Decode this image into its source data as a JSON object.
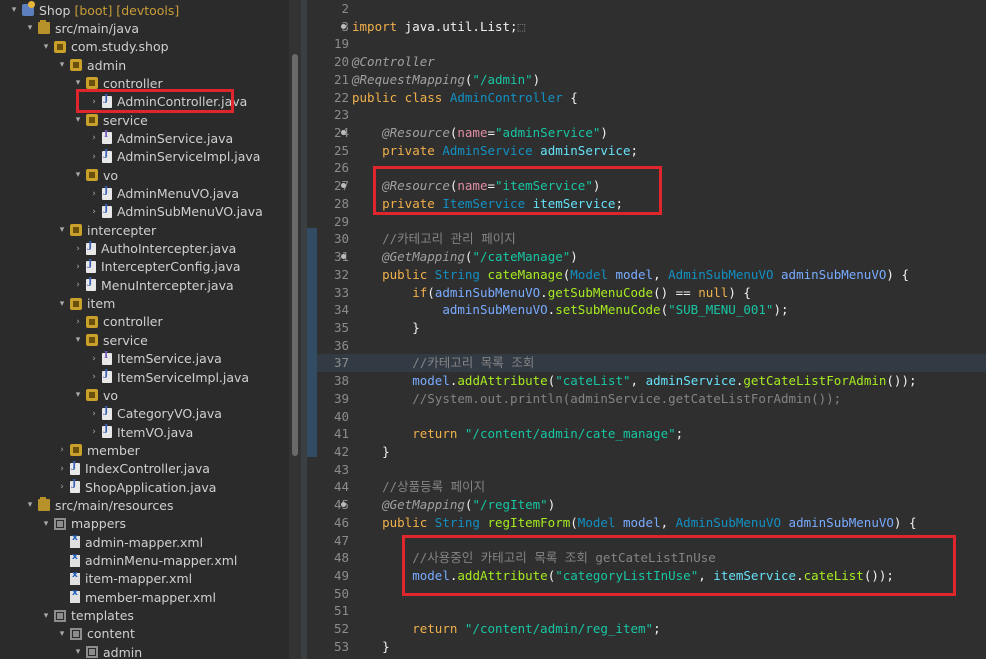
{
  "explorer": {
    "rows": [
      {
        "indent": 0,
        "arrow": "▾",
        "icon": "proj",
        "name": "project-icon",
        "text": "Shop",
        "tags": "[boot] [devtools]"
      },
      {
        "indent": 1,
        "arrow": "▾",
        "icon": "srcf",
        "name": "source-folder-icon",
        "text": "src/main/java",
        "tags": ""
      },
      {
        "indent": 2,
        "arrow": "▾",
        "icon": "pkg",
        "name": "package-icon",
        "text": "com.study.shop",
        "tags": ""
      },
      {
        "indent": 3,
        "arrow": "▾",
        "icon": "pkg",
        "name": "package-icon",
        "text": "admin",
        "tags": ""
      },
      {
        "indent": 4,
        "arrow": "▾",
        "icon": "pkg",
        "name": "package-icon",
        "text": "controller",
        "tags": ""
      },
      {
        "indent": 5,
        "arrow": "›",
        "icon": "java",
        "name": "java-file-icon",
        "text": "AdminController.java",
        "tags": ""
      },
      {
        "indent": 4,
        "arrow": "▾",
        "icon": "pkg",
        "name": "package-icon",
        "text": "service",
        "tags": ""
      },
      {
        "indent": 5,
        "arrow": "›",
        "icon": "javaint",
        "name": "java-interface-icon",
        "text": "AdminService.java",
        "tags": ""
      },
      {
        "indent": 5,
        "arrow": "›",
        "icon": "java",
        "name": "java-file-icon",
        "text": "AdminServiceImpl.java",
        "tags": ""
      },
      {
        "indent": 4,
        "arrow": "▾",
        "icon": "pkg",
        "name": "package-icon",
        "text": "vo",
        "tags": ""
      },
      {
        "indent": 5,
        "arrow": "›",
        "icon": "java",
        "name": "java-file-icon",
        "text": "AdminMenuVO.java",
        "tags": ""
      },
      {
        "indent": 5,
        "arrow": "›",
        "icon": "java",
        "name": "java-file-icon",
        "text": "AdminSubMenuVO.java",
        "tags": ""
      },
      {
        "indent": 3,
        "arrow": "▾",
        "icon": "pkg",
        "name": "package-icon",
        "text": "intercepter",
        "tags": ""
      },
      {
        "indent": 4,
        "arrow": "›",
        "icon": "java",
        "name": "java-file-icon",
        "text": "AuthoIntercepter.java",
        "tags": ""
      },
      {
        "indent": 4,
        "arrow": "›",
        "icon": "java",
        "name": "java-file-icon",
        "text": "IntercepterConfig.java",
        "tags": ""
      },
      {
        "indent": 4,
        "arrow": "›",
        "icon": "java",
        "name": "java-file-icon",
        "text": "MenuIntercepter.java",
        "tags": ""
      },
      {
        "indent": 3,
        "arrow": "▾",
        "icon": "pkg",
        "name": "package-icon",
        "text": "item",
        "tags": ""
      },
      {
        "indent": 4,
        "arrow": "›",
        "icon": "pkg",
        "name": "package-icon",
        "text": "controller",
        "tags": ""
      },
      {
        "indent": 4,
        "arrow": "▾",
        "icon": "pkg",
        "name": "package-icon",
        "text": "service",
        "tags": ""
      },
      {
        "indent": 5,
        "arrow": "›",
        "icon": "javaint",
        "name": "java-interface-icon",
        "text": "ItemService.java",
        "tags": ""
      },
      {
        "indent": 5,
        "arrow": "›",
        "icon": "java",
        "name": "java-file-icon",
        "text": "ItemServiceImpl.java",
        "tags": ""
      },
      {
        "indent": 4,
        "arrow": "▾",
        "icon": "pkg",
        "name": "package-icon",
        "text": "vo",
        "tags": ""
      },
      {
        "indent": 5,
        "arrow": "›",
        "icon": "java",
        "name": "java-file-icon",
        "text": "CategoryVO.java",
        "tags": ""
      },
      {
        "indent": 5,
        "arrow": "›",
        "icon": "java",
        "name": "java-file-icon",
        "text": "ItemVO.java",
        "tags": ""
      },
      {
        "indent": 3,
        "arrow": "›",
        "icon": "pkg",
        "name": "package-icon",
        "text": "member",
        "tags": ""
      },
      {
        "indent": 3,
        "arrow": "›",
        "icon": "java",
        "name": "java-file-icon",
        "text": "IndexController.java",
        "tags": ""
      },
      {
        "indent": 3,
        "arrow": "›",
        "icon": "java",
        "name": "java-file-icon",
        "text": "ShopApplication.java",
        "tags": ""
      },
      {
        "indent": 1,
        "arrow": "▾",
        "icon": "srcf",
        "name": "source-folder-icon",
        "text": "src/main/resources",
        "tags": ""
      },
      {
        "indent": 2,
        "arrow": "▾",
        "icon": "fold",
        "name": "folder-icon",
        "text": "mappers",
        "tags": ""
      },
      {
        "indent": 3,
        "arrow": "",
        "icon": "xml",
        "name": "xml-file-icon",
        "text": "admin-mapper.xml",
        "tags": ""
      },
      {
        "indent": 3,
        "arrow": "",
        "icon": "xml",
        "name": "xml-file-icon",
        "text": "adminMenu-mapper.xml",
        "tags": ""
      },
      {
        "indent": 3,
        "arrow": "",
        "icon": "xml",
        "name": "xml-file-icon",
        "text": "item-mapper.xml",
        "tags": ""
      },
      {
        "indent": 3,
        "arrow": "",
        "icon": "xml",
        "name": "xml-file-icon",
        "text": "member-mapper.xml",
        "tags": ""
      },
      {
        "indent": 2,
        "arrow": "▾",
        "icon": "fold",
        "name": "folder-icon",
        "text": "templates",
        "tags": ""
      },
      {
        "indent": 3,
        "arrow": "▾",
        "icon": "fold",
        "name": "folder-icon",
        "text": "content",
        "tags": ""
      },
      {
        "indent": 4,
        "arrow": "▾",
        "icon": "fold",
        "name": "folder-icon",
        "text": "admin",
        "tags": ""
      }
    ]
  },
  "editor": {
    "lines": [
      {
        "n": "2",
        "fold": false,
        "hl": false,
        "t": []
      },
      {
        "n": "3",
        "fold": true,
        "hl": false,
        "t": [
          [
            "kw",
            "import"
          ],
          [
            "var",
            " java.util.List;"
          ],
          [
            "cmt",
            "⬚"
          ]
        ]
      },
      {
        "n": "19",
        "fold": false,
        "hl": false,
        "t": []
      },
      {
        "n": "20",
        "fold": false,
        "hl": false,
        "t": [
          [
            "ann",
            "@Controller"
          ]
        ]
      },
      {
        "n": "21",
        "fold": false,
        "hl": false,
        "t": [
          [
            "ann",
            "@RequestMapping"
          ],
          [
            "var",
            "("
          ],
          [
            "str",
            "\"/admin\""
          ],
          [
            "var",
            ")"
          ]
        ]
      },
      {
        "n": "22",
        "fold": false,
        "hl": false,
        "t": [
          [
            "kw",
            "public class "
          ],
          [
            "typ",
            "AdminController"
          ],
          [
            "var",
            " {"
          ]
        ]
      },
      {
        "n": "23",
        "fold": false,
        "hl": false,
        "t": []
      },
      {
        "n": "24",
        "fold": true,
        "hl": false,
        "t": [
          [
            "var",
            "    "
          ],
          [
            "ann",
            "@Resource"
          ],
          [
            "var",
            "("
          ],
          [
            "attr",
            "name"
          ],
          [
            "var",
            "="
          ],
          [
            "str",
            "\"adminService\""
          ],
          [
            "var",
            ")"
          ]
        ]
      },
      {
        "n": "25",
        "fold": false,
        "hl": false,
        "t": [
          [
            "var",
            "    "
          ],
          [
            "kw",
            "private "
          ],
          [
            "typ",
            "AdminService"
          ],
          [
            "fld",
            " adminService"
          ],
          [
            "var",
            ";"
          ]
        ]
      },
      {
        "n": "26",
        "fold": false,
        "hl": false,
        "t": []
      },
      {
        "n": "27",
        "fold": true,
        "hl": false,
        "t": [
          [
            "var",
            "    "
          ],
          [
            "ann",
            "@Resource"
          ],
          [
            "var",
            "("
          ],
          [
            "attr",
            "name"
          ],
          [
            "var",
            "="
          ],
          [
            "str",
            "\"itemService\""
          ],
          [
            "var",
            ")"
          ]
        ]
      },
      {
        "n": "28",
        "fold": false,
        "hl": false,
        "t": [
          [
            "var",
            "    "
          ],
          [
            "kw",
            "private "
          ],
          [
            "typ",
            "ItemService"
          ],
          [
            "fld",
            " itemService"
          ],
          [
            "var",
            ";"
          ]
        ]
      },
      {
        "n": "29",
        "fold": false,
        "hl": false,
        "t": []
      },
      {
        "n": "30",
        "fold": false,
        "hl": false,
        "t": [
          [
            "var",
            "    "
          ],
          [
            "cmt",
            "//카테고리 관리 페이지"
          ]
        ]
      },
      {
        "n": "31",
        "fold": true,
        "hl": false,
        "t": [
          [
            "var",
            "    "
          ],
          [
            "ann",
            "@GetMapping"
          ],
          [
            "var",
            "("
          ],
          [
            "str",
            "\"/cateManage\""
          ],
          [
            "var",
            ")"
          ]
        ]
      },
      {
        "n": "32",
        "fold": false,
        "hl": false,
        "t": [
          [
            "var",
            "    "
          ],
          [
            "kw",
            "public "
          ],
          [
            "typ",
            "String"
          ],
          [
            "mth",
            " cateManage"
          ],
          [
            "var",
            "("
          ],
          [
            "typ",
            "Model"
          ],
          [
            "prm",
            " model"
          ],
          [
            "var",
            ", "
          ],
          [
            "typ",
            "AdminSubMenuVO"
          ],
          [
            "prm",
            " adminSubMenuVO"
          ],
          [
            "var",
            ") {"
          ]
        ]
      },
      {
        "n": "33",
        "fold": false,
        "hl": false,
        "t": [
          [
            "var",
            "        "
          ],
          [
            "kw",
            "if"
          ],
          [
            "var",
            "("
          ],
          [
            "prm",
            "adminSubMenuVO"
          ],
          [
            "var",
            "."
          ],
          [
            "mth",
            "getSubMenuCode"
          ],
          [
            "var",
            "() == "
          ],
          [
            "kw",
            "null"
          ],
          [
            "var",
            ") {"
          ]
        ]
      },
      {
        "n": "34",
        "fold": false,
        "hl": false,
        "t": [
          [
            "var",
            "            "
          ],
          [
            "prm",
            "adminSubMenuVO"
          ],
          [
            "var",
            "."
          ],
          [
            "mth",
            "setSubMenuCode"
          ],
          [
            "var",
            "("
          ],
          [
            "str",
            "\"SUB_MENU_001\""
          ],
          [
            "var",
            ");"
          ]
        ]
      },
      {
        "n": "35",
        "fold": false,
        "hl": false,
        "t": [
          [
            "var",
            "        }"
          ]
        ]
      },
      {
        "n": "36",
        "fold": false,
        "hl": false,
        "t": []
      },
      {
        "n": "37",
        "fold": false,
        "hl": true,
        "t": [
          [
            "var",
            "        "
          ],
          [
            "cmt",
            "//카테고리 목록 조회"
          ]
        ]
      },
      {
        "n": "38",
        "fold": false,
        "hl": false,
        "t": [
          [
            "var",
            "        "
          ],
          [
            "prm",
            "model"
          ],
          [
            "var",
            "."
          ],
          [
            "mth",
            "addAttribute"
          ],
          [
            "var",
            "("
          ],
          [
            "str",
            "\"cateList\""
          ],
          [
            "var",
            ", "
          ],
          [
            "fld",
            "adminService"
          ],
          [
            "var",
            "."
          ],
          [
            "mth",
            "getCateListForAdmin"
          ],
          [
            "var",
            "());"
          ]
        ]
      },
      {
        "n": "39",
        "fold": false,
        "hl": false,
        "t": [
          [
            "var",
            "        "
          ],
          [
            "cmt",
            "//System.out.println(adminService.getCateListForAdmin());"
          ]
        ]
      },
      {
        "n": "40",
        "fold": false,
        "hl": false,
        "t": []
      },
      {
        "n": "41",
        "fold": false,
        "hl": false,
        "t": [
          [
            "var",
            "        "
          ],
          [
            "kw",
            "return "
          ],
          [
            "str",
            "\"/content/admin/cate_manage\""
          ],
          [
            "var",
            ";"
          ]
        ]
      },
      {
        "n": "42",
        "fold": false,
        "hl": false,
        "t": [
          [
            "var",
            "    }"
          ]
        ]
      },
      {
        "n": "43",
        "fold": false,
        "hl": false,
        "t": []
      },
      {
        "n": "44",
        "fold": false,
        "hl": false,
        "t": [
          [
            "var",
            "    "
          ],
          [
            "cmt",
            "//상품등록 페이지"
          ]
        ]
      },
      {
        "n": "45",
        "fold": true,
        "hl": false,
        "t": [
          [
            "var",
            "    "
          ],
          [
            "ann",
            "@GetMapping"
          ],
          [
            "var",
            "("
          ],
          [
            "str",
            "\"/regItem\""
          ],
          [
            "var",
            ")"
          ]
        ]
      },
      {
        "n": "46",
        "fold": false,
        "hl": false,
        "t": [
          [
            "var",
            "    "
          ],
          [
            "kw",
            "public "
          ],
          [
            "typ",
            "String"
          ],
          [
            "mth",
            " regItemForm"
          ],
          [
            "var",
            "("
          ],
          [
            "typ",
            "Model"
          ],
          [
            "prm",
            " model"
          ],
          [
            "var",
            ", "
          ],
          [
            "typ",
            "AdminSubMenuVO"
          ],
          [
            "prm",
            " adminSubMenuVO"
          ],
          [
            "var",
            ") {"
          ]
        ]
      },
      {
        "n": "47",
        "fold": false,
        "hl": false,
        "t": []
      },
      {
        "n": "48",
        "fold": false,
        "hl": false,
        "t": [
          [
            "var",
            "        "
          ],
          [
            "cmt",
            "//사용중인 카테고리 목록 조회 getCateListInUse"
          ]
        ]
      },
      {
        "n": "49",
        "fold": false,
        "hl": false,
        "t": [
          [
            "var",
            "        "
          ],
          [
            "prm",
            "model"
          ],
          [
            "var",
            "."
          ],
          [
            "mth",
            "addAttribute"
          ],
          [
            "var",
            "("
          ],
          [
            "str",
            "\"categoryListInUse\""
          ],
          [
            "var",
            ", "
          ],
          [
            "fld",
            "itemService"
          ],
          [
            "var",
            "."
          ],
          [
            "mth",
            "cateList"
          ],
          [
            "var",
            "());"
          ]
        ]
      },
      {
        "n": "50",
        "fold": false,
        "hl": false,
        "t": []
      },
      {
        "n": "51",
        "fold": false,
        "hl": false,
        "t": []
      },
      {
        "n": "52",
        "fold": false,
        "hl": false,
        "t": [
          [
            "var",
            "        "
          ],
          [
            "kw",
            "return "
          ],
          [
            "str",
            "\"/content/admin/reg_item\""
          ],
          [
            "var",
            ";"
          ]
        ]
      },
      {
        "n": "53",
        "fold": false,
        "hl": false,
        "t": [
          [
            "var",
            "    }"
          ]
        ]
      },
      {
        "n": "54",
        "fold": false,
        "hl": false,
        "t": []
      }
    ]
  }
}
